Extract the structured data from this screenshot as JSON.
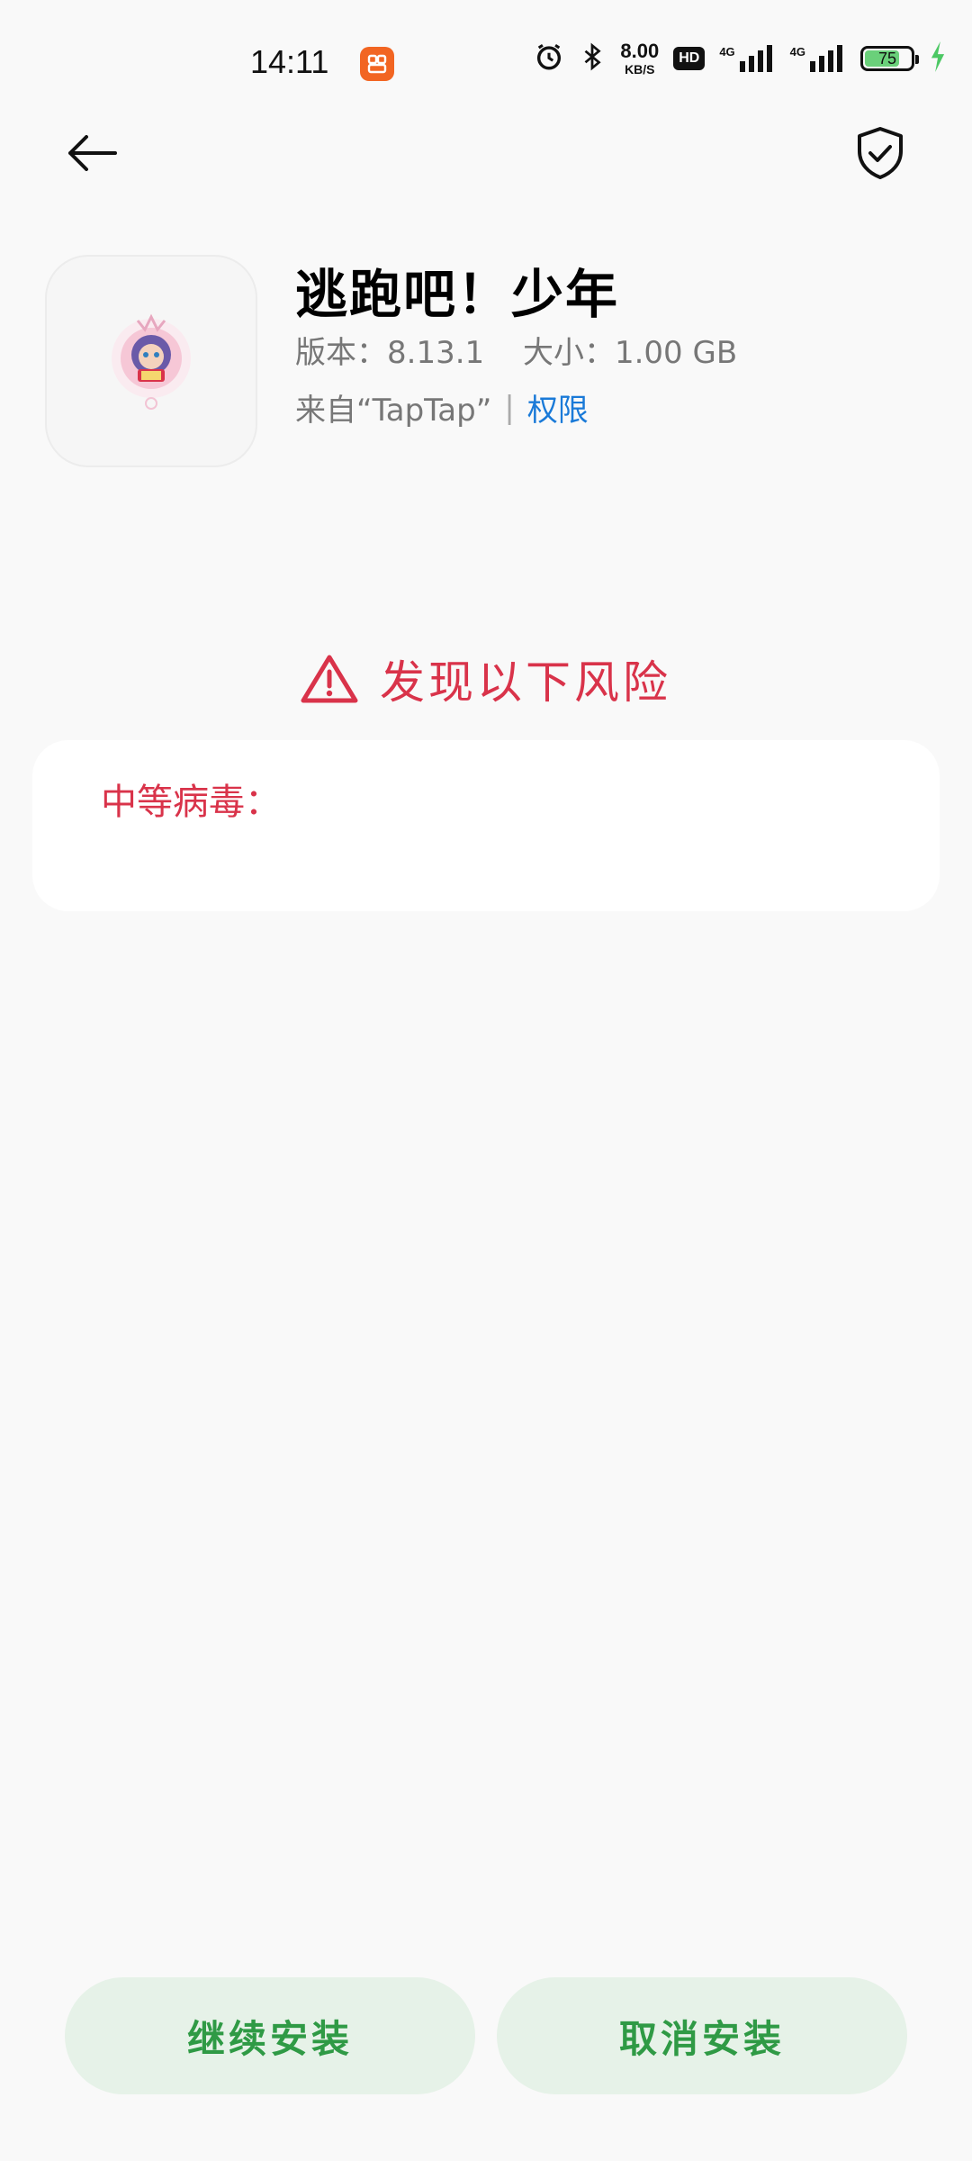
{
  "status_bar": {
    "time": "14:11",
    "net_speed_value": "8.00",
    "net_speed_unit": "KB/S",
    "hd_badge": "HD",
    "signal_1_label": "4G",
    "signal_2_label": "4G",
    "battery_level": "75",
    "battery_color": "#6ad07a",
    "icons": [
      "app-badge-icon",
      "alarm-icon",
      "bluetooth-icon",
      "charging-icon"
    ]
  },
  "header": {
    "back_icon": "arrow-left-icon",
    "security_icon": "shield-check-icon"
  },
  "app": {
    "name": "逃跑吧！少年",
    "version_label": "版本：8.13.1",
    "size_label": "大小：1.00 GB",
    "source_label": "来自“TapTap”",
    "separator": "|",
    "permissions_label": "权限"
  },
  "risk": {
    "heading": "发现以下风险",
    "category": "中等病毒："
  },
  "buttons": {
    "continue_label": "继续安装",
    "cancel_label": "取消安装"
  },
  "colors": {
    "accent_red": "#d9334a",
    "accent_green": "#2f9a45",
    "button_bg": "#e6f2e8",
    "link_blue": "#1a7ad8"
  }
}
